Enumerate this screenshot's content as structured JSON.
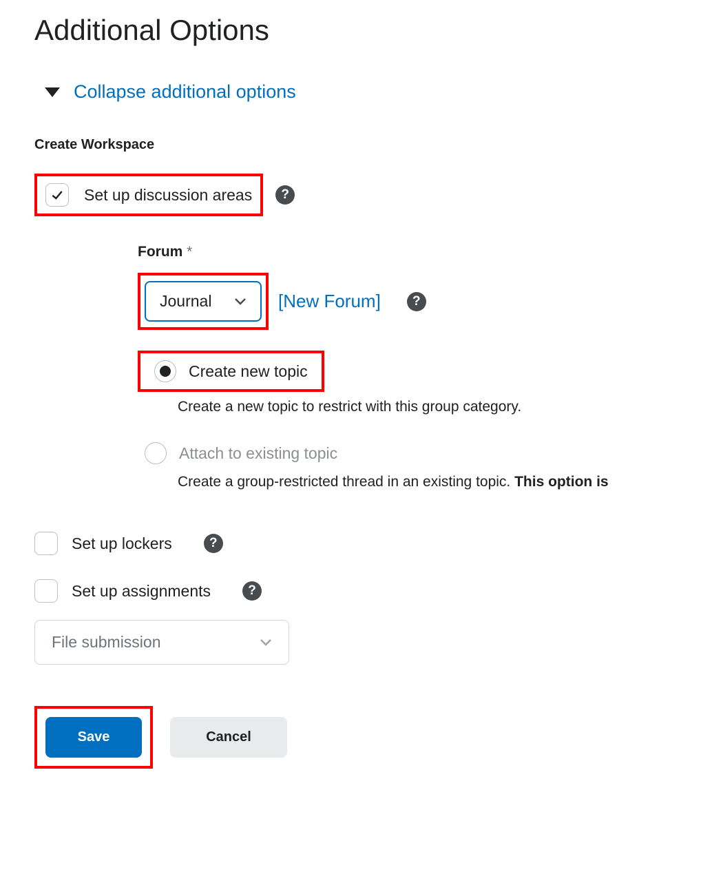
{
  "title": "Additional Options",
  "collapse_label": "Collapse additional options",
  "workspace": {
    "section_label": "Create Workspace",
    "discussion": {
      "label": "Set up discussion areas",
      "checked": true
    },
    "lockers": {
      "label": "Set up lockers",
      "checked": false
    },
    "assignments": {
      "label": "Set up assignments",
      "checked": false
    }
  },
  "forum": {
    "label": "Forum",
    "required_marker": "*",
    "selected": "Journal",
    "new_forum_link": "[New Forum]",
    "radio": {
      "create": {
        "label": "Create new topic",
        "desc": "Create a new topic to restrict with this group category.",
        "selected": true
      },
      "attach": {
        "label": "Attach to existing topic",
        "desc_prefix": "Create a group-restricted thread in an existing topic. ",
        "desc_bold": "This option is",
        "selected": false
      }
    }
  },
  "assignment_type": {
    "selected": "File submission"
  },
  "buttons": {
    "save": "Save",
    "cancel": "Cancel"
  }
}
